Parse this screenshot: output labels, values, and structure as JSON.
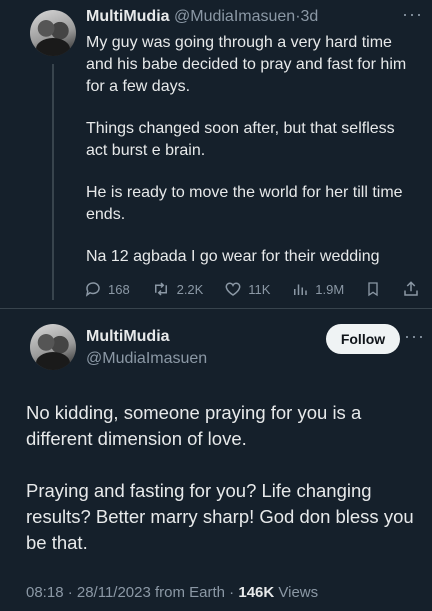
{
  "reply_tweet": {
    "display_name": "MultiMudia",
    "handle": "@MudiaImasuen",
    "separator": "·",
    "time": "3d",
    "more": "···",
    "paragraphs": [
      "My guy was going through a very hard time and his babe decided to pray and fast for him for a few days.",
      "Things changed soon after, but that selfless act burst e brain.",
      "He is ready to move the world for her till time ends.",
      "Na 12 agbada I go wear for their wedding"
    ],
    "stats": {
      "replies": "168",
      "retweets": "2.2K",
      "likes": "11K",
      "views": "1.9M"
    },
    "icons": [
      "reply-icon",
      "retweet-icon",
      "like-icon",
      "views-icon",
      "bookmark-icon",
      "share-icon"
    ]
  },
  "main_tweet": {
    "display_name": "MultiMudia",
    "handle": "@MudiaImasuen",
    "follow_label": "Follow",
    "more": "···",
    "paragraphs": [
      "No kidding, someone praying for you is a different dimension of love.",
      "Praying and fasting for you? Life changing results? Better marry sharp! God don bless you be that."
    ],
    "timestamp": "08:18 · 28/11/2023 from Earth ·",
    "views_count": "146K",
    "views_label": "Views"
  },
  "colors": {
    "background": "#15202b",
    "text": "#e7e9ea",
    "muted": "#8b98a5",
    "divider": "#38444d",
    "follow_bg": "#eff3f4"
  }
}
